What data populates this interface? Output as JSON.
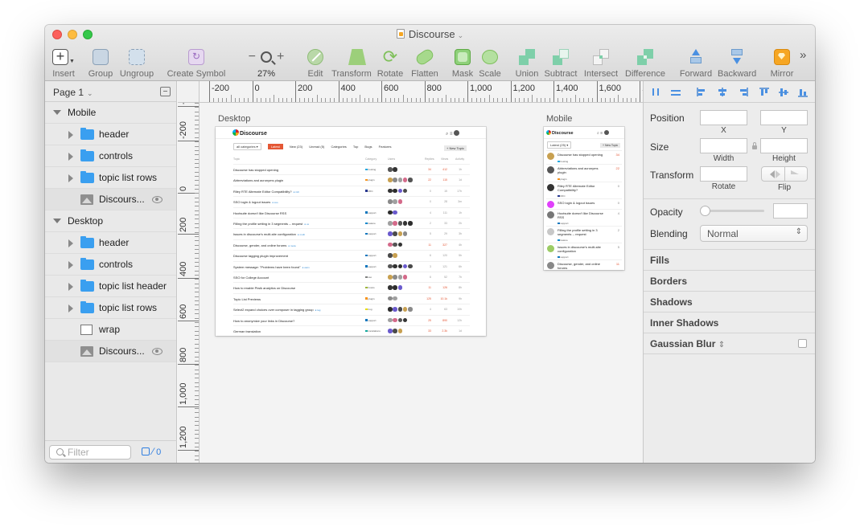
{
  "window": {
    "title": "Discourse"
  },
  "toolbar": {
    "insert": "Insert",
    "group": "Group",
    "ungroup": "Ungroup",
    "create_symbol": "Create Symbol",
    "zoom": "27%",
    "edit": "Edit",
    "transform": "Transform",
    "rotate": "Rotate",
    "flatten": "Flatten",
    "mask": "Mask",
    "scale": "Scale",
    "union": "Union",
    "subtract": "Subtract",
    "intersect": "Intersect",
    "difference": "Difference",
    "forward": "Forward",
    "backward": "Backward",
    "mirror": "Mirror",
    "more": "»"
  },
  "sidebar": {
    "page": "Page 1",
    "mobile_group": "Mobile",
    "mobile_layers": [
      "header",
      "controls",
      "topic list rows",
      "Discours..."
    ],
    "desktop_group": "Desktop",
    "desktop_layers": [
      "header",
      "controls",
      "topic list header",
      "topic list rows",
      "wrap",
      "Discours..."
    ],
    "filter_placeholder": "Filter",
    "count": "0"
  },
  "rulers": {
    "h_labels": [
      "-200",
      "0",
      "200",
      "400",
      "600",
      "800",
      "1,000",
      "1,200",
      "1,400",
      "1,600",
      "1"
    ],
    "v_labels": [
      "-4",
      "-200",
      "0",
      "200",
      "400",
      "600",
      "800",
      "1,000",
      "1,200"
    ]
  },
  "artboards": {
    "desktop_label": "Desktop",
    "mobile_label": "Mobile",
    "logo": "Discourse",
    "nav": [
      "all categories ▾",
      "Latest",
      "New (23)",
      "Unread (5)",
      "Categories",
      "Top",
      "Bugs",
      "Features"
    ],
    "new_topic": "+ New Topic",
    "columns": [
      "Topic",
      "Category",
      "Users",
      "Replies",
      "Views",
      "Activity"
    ],
    "topics": [
      {
        "title": "Discourse has stopped opening",
        "cat": "hosting",
        "color": "#25aae1",
        "replies": "34",
        "views": "412",
        "act": "1h",
        "hot": true
      },
      {
        "title": "Abbreviations and acronyms plugin",
        "cat": "plugin",
        "color": "#f7941d",
        "replies": "22",
        "views": "115",
        "act": "1d",
        "hot": true
      },
      {
        "title": "Riley RTE Alternate Editor Compatibility?",
        "cat": "RFC",
        "color": "#283890",
        "replies": "0",
        "views": "15",
        "act": "17h",
        "hot": false,
        "tag": "rich"
      },
      {
        "title": "SSO login & logout issues",
        "cat": "",
        "color": "#ffffff",
        "replies": "0",
        "views": "28",
        "act": "3m",
        "hot": false,
        "tag": "sso"
      },
      {
        "title": "Hootsuite doesn't like Discourse RSS",
        "cat": "support",
        "color": "#0e76bd",
        "replies": "4",
        "views": "111",
        "act": "1h",
        "hot": false
      },
      {
        "title": "Filling the profile setting in 3 segments -- request",
        "cat": "feature",
        "color": "#0088cc",
        "replies": "2",
        "views": "33",
        "act": "2h",
        "hot": false,
        "tag": "ux"
      },
      {
        "title": "Issues in discourse's multi-site configuration",
        "cat": "support",
        "color": "#0e76bd",
        "replies": "5",
        "views": "29",
        "act": "3h",
        "hot": false,
        "tag": "multi"
      },
      {
        "title": "Discourse, gender, and online forums",
        "cat": "",
        "color": "#ffffff",
        "replies": "11",
        "views": "327",
        "act": "4h",
        "hot": true,
        "tag": "meta"
      },
      {
        "title": "Discourse tagging plugin improvement",
        "cat": "support",
        "color": "#0e76bd",
        "replies": "6",
        "views": "120",
        "act": "5h",
        "hot": false
      },
      {
        "title": "System message: \"Problems have been found\"",
        "cat": "support",
        "color": "#0e76bd",
        "replies": "3",
        "views": "121",
        "act": "6h",
        "hot": false,
        "tag": "warn"
      },
      {
        "title": "SSO for College Account",
        "cat": "sso",
        "color": "#808281",
        "replies": "6",
        "views": "52",
        "act": "7h",
        "hot": false
      },
      {
        "title": "How to enable Piwik analytics on Discourse",
        "cat": "howto",
        "color": "#9eb83b",
        "replies": "11",
        "views": "126",
        "act": "8h",
        "hot": true
      },
      {
        "title": "Topic List Previews",
        "cat": "plugin",
        "color": "#f7941d",
        "replies": "125",
        "views": "10.1k",
        "act": "9h",
        "hot": true
      },
      {
        "title": "Select2 expand choices over composer in tagging group",
        "cat": "bug",
        "color": "#e9dd00",
        "replies": "4",
        "views": "63",
        "act": "10h",
        "hot": false,
        "tag": "tag"
      },
      {
        "title": "How to anonymize your links in Discourse?",
        "cat": "support",
        "color": "#0e76bd",
        "replies": "25",
        "views": "890",
        "act": "12h",
        "hot": true
      },
      {
        "title": "German translation",
        "cat": "translations",
        "color": "#12a89d",
        "replies": "33",
        "views": "2.3k",
        "act": "1d",
        "hot": true
      }
    ],
    "mobile_filter": "Latest (25) ▾",
    "mobile_new": "+ New Topic"
  },
  "inspector": {
    "position": "Position",
    "x": "X",
    "y": "Y",
    "size": "Size",
    "width": "Width",
    "height": "Height",
    "transform": "Transform",
    "rotate": "Rotate",
    "flip": "Flip",
    "opacity": "Opacity",
    "blending": "Blending",
    "blending_value": "Normal",
    "fills": "Fills",
    "borders": "Borders",
    "shadows": "Shadows",
    "inner_shadows": "Inner Shadows",
    "gaussian_blur": "Gaussian Blur"
  },
  "colors": {
    "accent": "#3a9ff0",
    "discourse_orange": "#e45735"
  }
}
